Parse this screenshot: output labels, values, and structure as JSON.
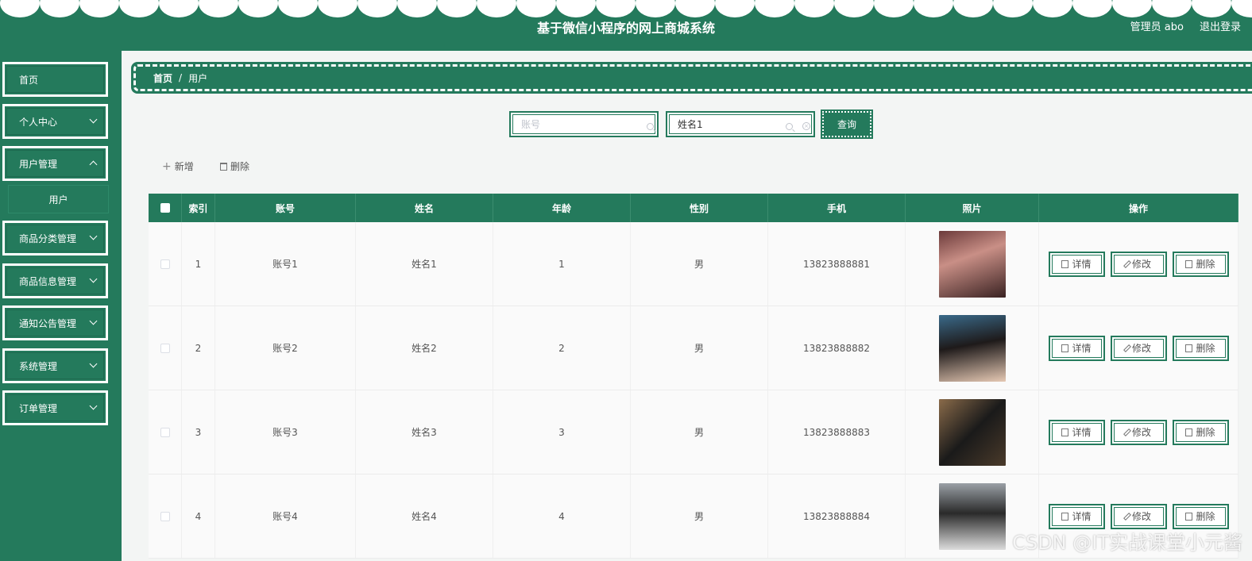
{
  "header": {
    "title": "基于微信小程序的网上商城系统",
    "admin": "管理员 abo",
    "logout": "退出登录"
  },
  "sidebar": {
    "items": [
      {
        "label": "首页"
      },
      {
        "label": "个人中心"
      },
      {
        "label": "用户管理"
      },
      {
        "label": "用户"
      },
      {
        "label": "商品分类管理"
      },
      {
        "label": "商品信息管理"
      },
      {
        "label": "通知公告管理"
      },
      {
        "label": "系统管理"
      },
      {
        "label": "订单管理"
      }
    ]
  },
  "breadcrumb": {
    "home": "首页",
    "separator": "/",
    "current": "用户"
  },
  "search": {
    "account_placeholder": "账号",
    "name_value": "姓名1",
    "query_label": "查询"
  },
  "actions": {
    "add": "新增",
    "delete": "删除"
  },
  "table": {
    "headers": [
      "索引",
      "账号",
      "姓名",
      "年龄",
      "性别",
      "手机",
      "照片",
      "操作"
    ],
    "rows": [
      {
        "index": "1",
        "account": "账号1",
        "name": "姓名1",
        "age": "1",
        "gender": "男",
        "phone": "13823888881"
      },
      {
        "index": "2",
        "account": "账号2",
        "name": "姓名2",
        "age": "2",
        "gender": "男",
        "phone": "13823888882"
      },
      {
        "index": "3",
        "account": "账号3",
        "name": "姓名3",
        "age": "3",
        "gender": "男",
        "phone": "13823888883"
      },
      {
        "index": "4",
        "account": "账号4",
        "name": "姓名4",
        "age": "4",
        "gender": "男",
        "phone": "13823888884"
      }
    ],
    "ops": {
      "detail": "详情",
      "edit": "修改",
      "delete": "删除"
    }
  },
  "watermark": "CSDN @IT实战课堂小元酱",
  "colors": {
    "primary": "#247a5c",
    "background": "#f3f5f4"
  }
}
